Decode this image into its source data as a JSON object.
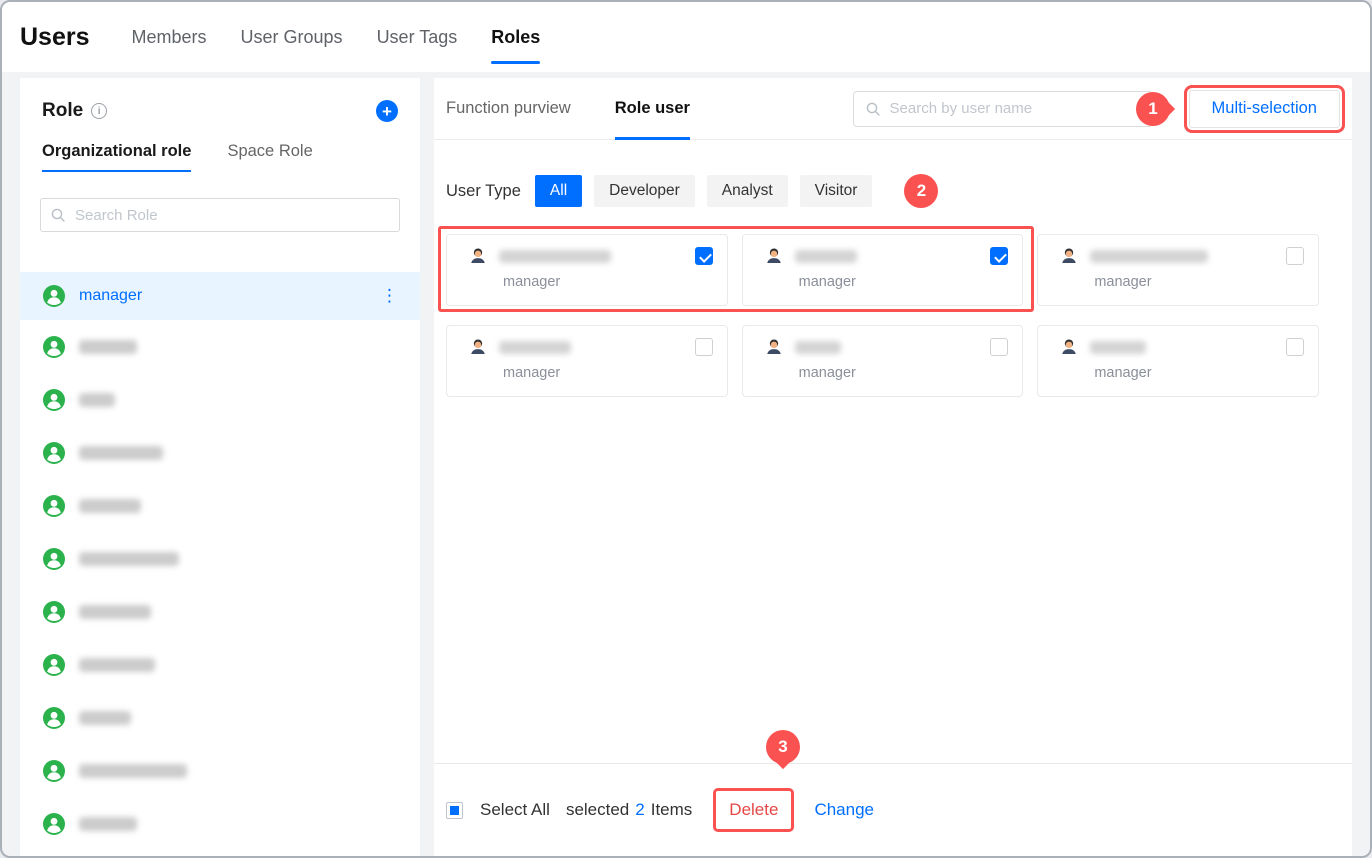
{
  "header": {
    "title": "Users",
    "tabs": [
      {
        "label": "Members",
        "active": false
      },
      {
        "label": "User Groups",
        "active": false
      },
      {
        "label": "User Tags",
        "active": false
      },
      {
        "label": "Roles",
        "active": true
      }
    ]
  },
  "sidebar": {
    "title": "Role",
    "add_label": "+",
    "info_label": "i",
    "tabs": [
      {
        "label": "Organizational role",
        "active": true
      },
      {
        "label": "Space Role",
        "active": false
      }
    ],
    "search_placeholder": "Search Role",
    "selected_role": {
      "name": "manager",
      "menu_icon": "⋮"
    },
    "redacted_widths": [
      58,
      36,
      84,
      62,
      100,
      72,
      76,
      52,
      108,
      58
    ]
  },
  "main": {
    "tabs": [
      {
        "label": "Function purview",
        "active": false
      },
      {
        "label": "Role user",
        "active": true
      }
    ],
    "search_placeholder": "Search by user name",
    "multi_selection_label": "Multi-selection",
    "user_type": {
      "label": "User Type",
      "options": [
        {
          "label": "All",
          "active": true
        },
        {
          "label": "Developer",
          "active": false
        },
        {
          "label": "Analyst",
          "active": false
        },
        {
          "label": "Visitor",
          "active": false
        }
      ]
    },
    "cards": [
      {
        "role": "manager",
        "checked": true,
        "name_w": 112
      },
      {
        "role": "manager",
        "checked": true,
        "name_w": 62
      },
      {
        "role": "manager",
        "checked": false,
        "name_w": 118
      },
      {
        "role": "manager",
        "checked": false,
        "name_w": 72
      },
      {
        "role": "manager",
        "checked": false,
        "name_w": 46
      },
      {
        "role": "manager",
        "checked": false,
        "name_w": 56
      }
    ],
    "footer": {
      "select_all_label": "Select All",
      "selected_prefix": "selected",
      "selected_count": "2",
      "selected_suffix": "Items",
      "delete_label": "Delete",
      "change_label": "Change"
    }
  },
  "annotations": {
    "badge1": "1",
    "badge2": "2",
    "badge3": "3"
  },
  "colors": {
    "accent_blue": "#006eff",
    "annotation_red": "#fa5151",
    "avatar_green": "#2bb24c",
    "delete_red": "#e64747",
    "selected_row_bg": "#e8f4ff"
  }
}
